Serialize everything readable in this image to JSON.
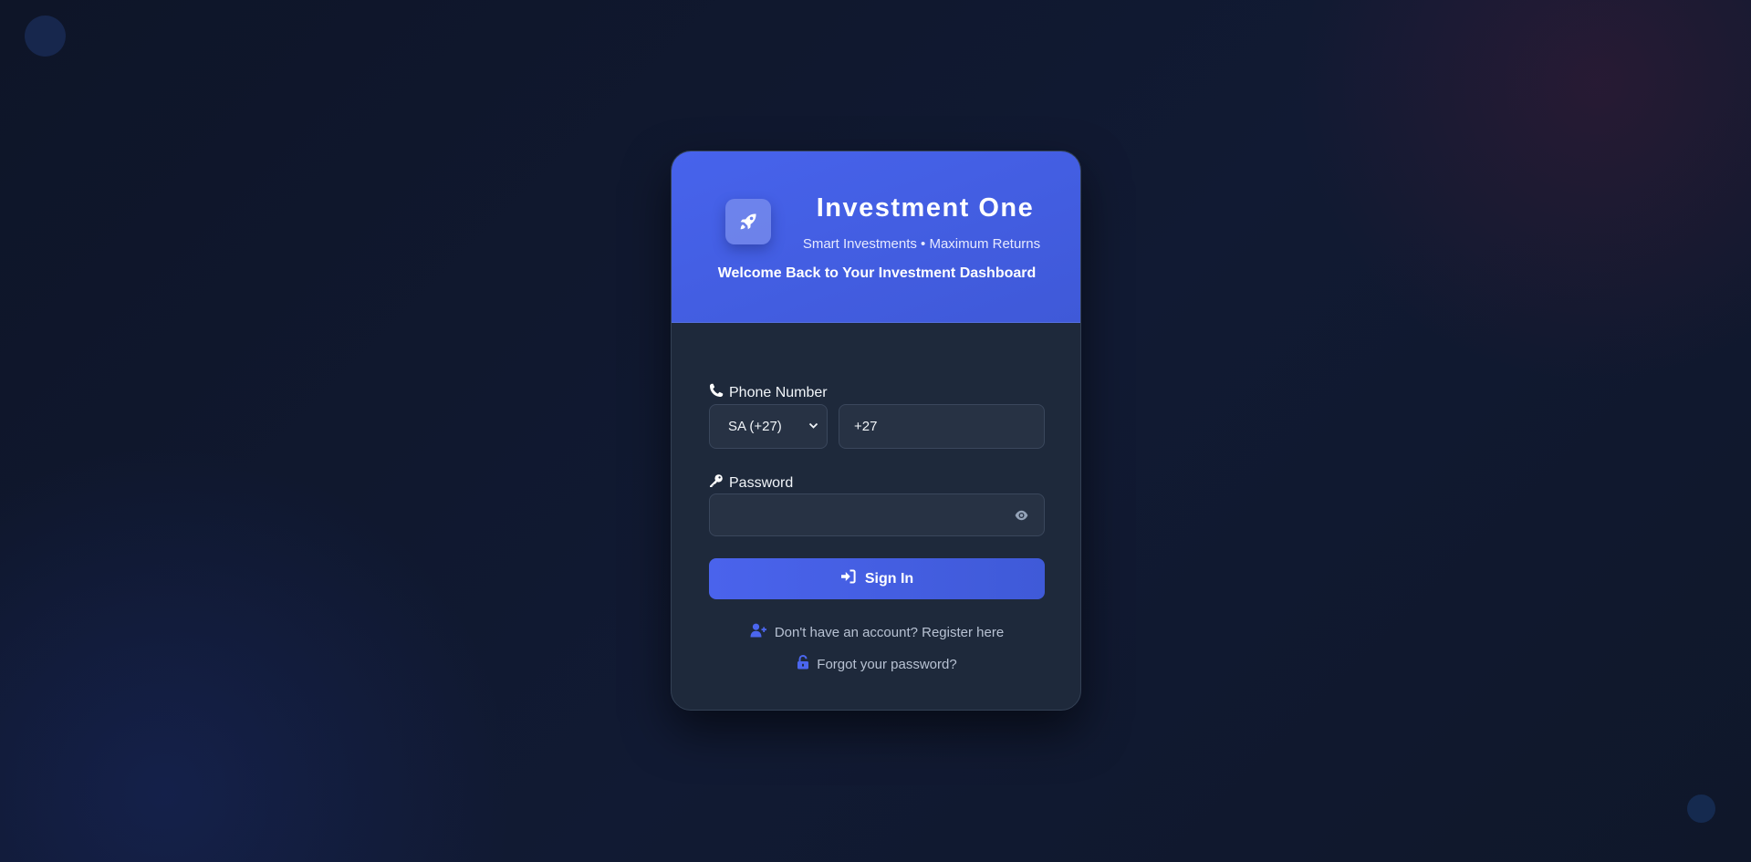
{
  "brand": {
    "title": "Investment One",
    "tagline": "Smart Investments • Maximum Returns",
    "welcome": "Welcome Back to Your Investment Dashboard"
  },
  "form": {
    "phone_label": "Phone Number",
    "country_code_selected": "SA (+27)",
    "phone_value": "+27",
    "password_label": "Password",
    "password_value": "",
    "sign_in_label": "Sign In"
  },
  "links": {
    "register": "Don't have an account? Register here",
    "forgot": "Forgot your password?"
  },
  "icons": {
    "logo": "rocket-icon",
    "phone": "phone-icon",
    "password": "key-icon",
    "toggle_visibility": "eye-icon",
    "sign_in": "sign-in-icon",
    "register": "user-plus-icon",
    "forgot": "lock-open-icon"
  },
  "colors": {
    "page_background": "#0f172a",
    "card_background": "#1e293b",
    "accent": "#4763ec",
    "link_icon": "#4b66ee",
    "text_primary": "#ffffff",
    "text_muted": "#b8c2d3"
  }
}
